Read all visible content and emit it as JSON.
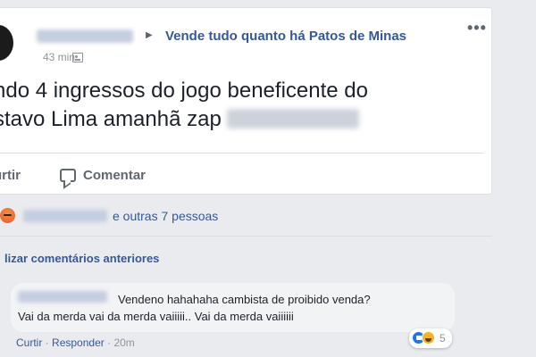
{
  "post": {
    "group": "Vende tudo quanto há Patos de Minas",
    "time": "43 min",
    "more_label": "•••",
    "text_line1": "ndo 4 ingressos do jogo beneficente do",
    "text_line2": "stavo Lima amanhã zap"
  },
  "actions": {
    "like": "urtir",
    "comment": "Comentar"
  },
  "reactions": {
    "others": "e outras 7 pessoas"
  },
  "comments": {
    "view_previous": "lizar comentários anteriores",
    "item": {
      "line1": "Vendeno hahahaha cambista de proibido venda?",
      "line2": "Vai da merda vai da merda vaiiiii.. Vai da merda vaiiiiii",
      "like_label": "Curtir",
      "separator": "·",
      "reply_label": "Responder",
      "time": "20m",
      "reaction_count": "5"
    }
  }
}
